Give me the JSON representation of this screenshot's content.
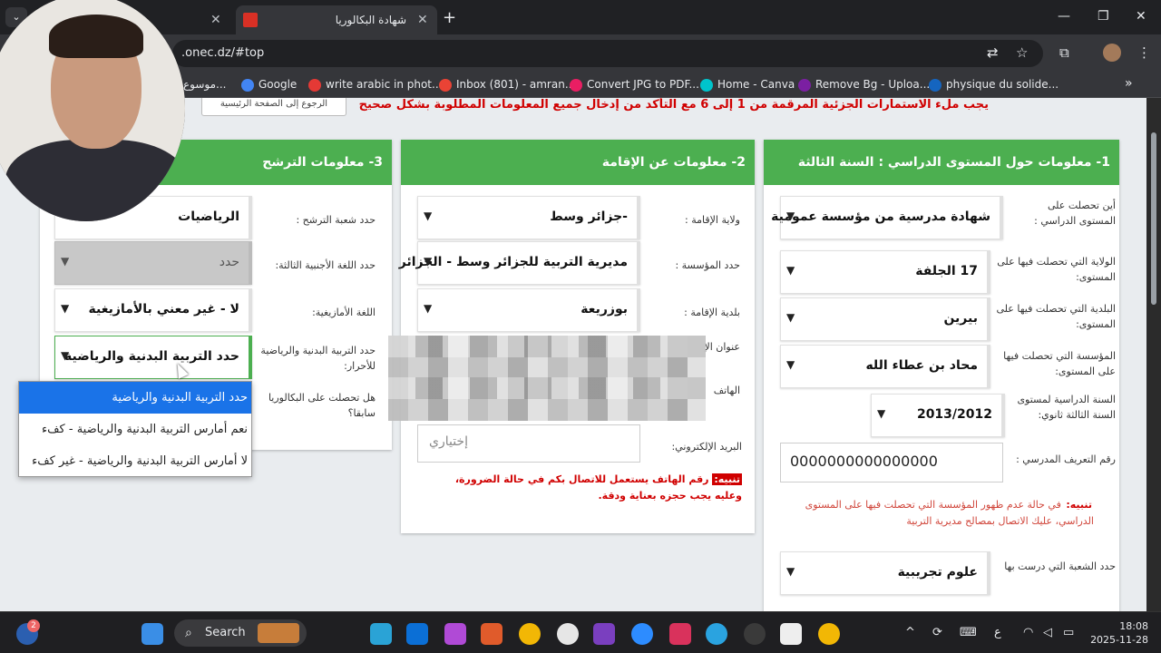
{
  "browser": {
    "active_tab_title": "شهادة البكالوريا",
    "url": ".onec.dz/#top",
    "bookmarks": [
      {
        "label": "موسوع...",
        "color": "#999999"
      },
      {
        "label": "Google",
        "color": "#4285f4"
      },
      {
        "label": "write arabic in phot...",
        "color": "#e53935"
      },
      {
        "label": "Inbox (801) - amran...",
        "color": "#ea4335"
      },
      {
        "label": "Convert JPG to PDF...",
        "color": "#e91e63"
      },
      {
        "label": "Home - Canva",
        "color": "#00c4cc"
      },
      {
        "label": "Remove Bg - Uploa...",
        "color": "#7b1fa2"
      },
      {
        "label": "physique du solide...",
        "color": "#1565c0"
      }
    ]
  },
  "page": {
    "notice": "يجب ملء الاستمارات الجزئية المرقمة من 1 إلى 6 مع التأكد من إدخال جميع المعلومات المطلوبة بشكل صحيح",
    "home_button": "الرجوع إلى الصفحة الرئيسية",
    "section1": {
      "title": "1- معلومات حول المستوى الدراسي : السنة الثالثة ثانوي",
      "fields": [
        {
          "label": "أين تحصلت على المستوى الدراسي :",
          "value": "شهادة مدرسية من مؤسسة عمومية"
        },
        {
          "label": "الولاية التي تحصلت فيها على المستوى:",
          "value": "17 الجلفة"
        },
        {
          "label": "البلدية التي تحصلت فيها على المستوى:",
          "value": "بيرين"
        },
        {
          "label": "المؤسسة التي تحصلت فيها على المستوى:",
          "value": "محاد بن عطاء الله"
        },
        {
          "label": "السنة الدراسية لمستوى السنة الثالثة ثانوي:",
          "value": "2013/2012"
        }
      ],
      "school_id_label": "رقم التعريف المدرسي :",
      "school_id_value": "0000000000000000",
      "warning_tag": "تنبيه:",
      "warning_text": "في حالة عدم ظهور المؤسسة التي تحصلت فيها على المستوى الدراسي، عليك الاتصال بمصالح مديرية التربية",
      "branch_label": "حدد الشعبة التي درست بها",
      "branch_value": "علوم تجريبية"
    },
    "section2": {
      "title": "2- معلومات عن الإقامة",
      "fields": [
        {
          "label": "ولاية الإقامة :",
          "value": "-جزائر وسط"
        },
        {
          "label": "حدد المؤسسة :",
          "value": "مديرية التربية للجزائر وسط - الجزائر"
        },
        {
          "label": "بلدية الإقامة :",
          "value": "بوزريعة"
        }
      ],
      "address_label": "عنوان الإ",
      "phone_label": "الهاتف",
      "email_label": "البريد الإلكتروني:",
      "email_placeholder": "إختياري",
      "warning_tag": "تنبيه:",
      "warning_text": "رقم الهاتف يستعمل للاتصال بكم في حالة الضرورة، وعليه يجب حجزه بعناية ودقة."
    },
    "section3": {
      "title": "3- معلومات الترشح",
      "fields": [
        {
          "label": "حدد شعبة الترشح :",
          "value": "الرياضيات"
        },
        {
          "label": "حدد اللغة الأجنبية الثالثة:",
          "value": "حدد"
        },
        {
          "label": "اللغة الأمازيغية:",
          "value": "لا - غير معني بالأمازيغية"
        },
        {
          "label": "حدد التربية البدنية والرياضية للأحرار:",
          "value": "حدد التربية البدنية والرياضية"
        }
      ],
      "prior_bac_label": "هل تحصلت على البكالوريا سابقا؟",
      "dropdown_options": [
        "حدد التربية البدنية والرياضية",
        "نعم أمارس التربية البدنية والرياضية - كفء",
        "لا أمارس التربية البدنية والرياضية - غير كفء"
      ]
    }
  },
  "taskbar": {
    "search_label": "Search",
    "time": "18:08",
    "date": "2025-11-28",
    "badge": "2",
    "lang": "ع"
  }
}
